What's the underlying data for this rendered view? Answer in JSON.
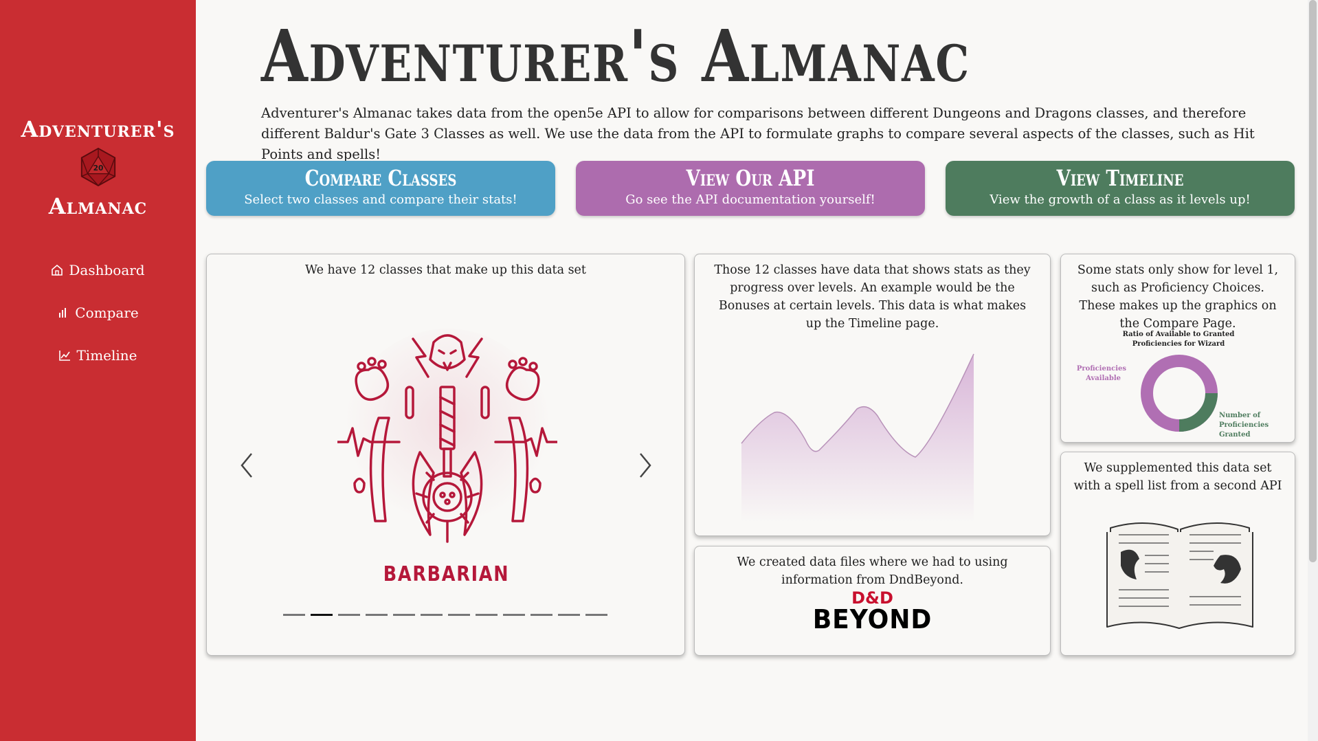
{
  "sidebar": {
    "brand_top": "Adventurer's",
    "brand_bottom": "Almanac",
    "die_value": "20",
    "nav": [
      {
        "label": "Dashboard",
        "icon": "home-icon"
      },
      {
        "label": "Compare",
        "icon": "bar-chart-icon"
      },
      {
        "label": "Timeline",
        "icon": "line-chart-icon"
      }
    ]
  },
  "header": {
    "title": "Adventurer's Almanac",
    "intro": "Adventurer's Almanac takes data from the open5e API to allow for comparisons between different Dungeons and Dragons classes, and therefore different Baldur's Gate 3 Classes as well. We use the data from the API to formulate graphs to compare several aspects of the classes, such as Hit Points and spells!"
  },
  "actions": [
    {
      "title": "Compare Classes",
      "subtitle": "Select two classes and compare their stats!",
      "color": "#4fa0c6"
    },
    {
      "title": "View Our API",
      "subtitle": "Go see the API documentation yourself!",
      "color": "#ad6cae"
    },
    {
      "title": "View Timeline",
      "subtitle": "View the growth of a class as it levels up!",
      "color": "#4e7c5e"
    }
  ],
  "cards": {
    "classes": {
      "text": "We have 12 classes that make up this data set",
      "slide_label": "BARBARIAN",
      "slide_count": 12,
      "active_slide": 2,
      "accent": "#b5183a"
    },
    "timeline": {
      "text": "Those 12 classes have data that shows stats as they progress over levels. An example would be the Bonuses at certain levels. This data is what makes up the Timeline page."
    },
    "dndbeyond": {
      "text": "We created data files where we had to using information from DndBeyond.",
      "logo_top": "D&D",
      "logo_bottom": "BEYOND"
    },
    "proficiency": {
      "text": "Some stats only show for level 1, such as Proficiency Choices. These makes up the graphics on the Compare Page.",
      "chart_title_1": "Ratio of Available to Granted",
      "chart_title_2": "Proficiencies for Wizard",
      "available_label_1": "Proficiencies",
      "available_label_2": "Available",
      "granted_label_1": "Number of",
      "granted_label_2": "Proficiencies",
      "granted_label_3": "Granted",
      "available_color": "#b06fb3",
      "granted_color": "#4e7c5e"
    },
    "spells": {
      "text": "We supplemented this data set with a spell list from a second API"
    }
  }
}
